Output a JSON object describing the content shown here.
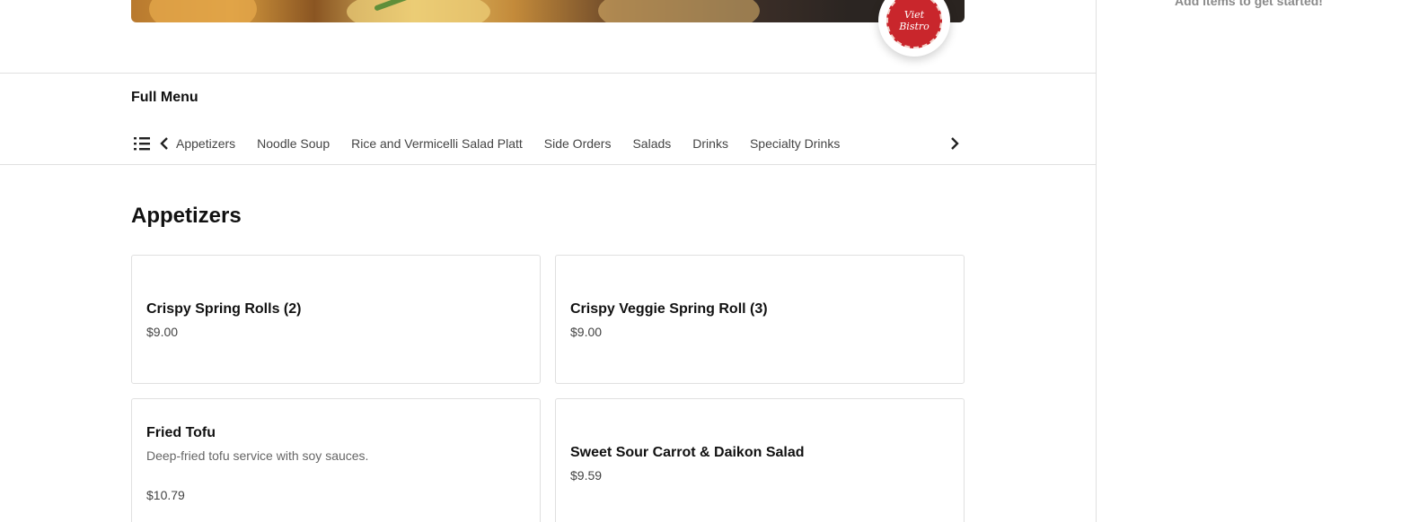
{
  "cart": {
    "empty_message": "Add items to get started!"
  },
  "restaurant": {
    "logo_text_line1": "Viet",
    "logo_text_line2": "Bistro"
  },
  "menu": {
    "title": "Full Menu",
    "categories": [
      "Appetizers",
      "Noodle Soup",
      "Rice and Vermicelli Salad Platt",
      "Side Orders",
      "Salads",
      "Drinks",
      "Specialty Drinks"
    ]
  },
  "section": {
    "title": "Appetizers",
    "items": [
      {
        "name": "Crispy Spring Rolls (2)",
        "description": "",
        "price": "$9.00"
      },
      {
        "name": "Crispy Veggie Spring Roll (3)",
        "description": "",
        "price": "$9.00"
      },
      {
        "name": "Fried Tofu",
        "description": "Deep-fried tofu service with soy sauces.",
        "price": "$10.79"
      },
      {
        "name": "Sweet Sour Carrot & Daikon Salad",
        "description": "",
        "price": "$9.59"
      }
    ]
  },
  "icons": {
    "list": "list-icon",
    "prev": "chevron-left-icon",
    "next": "chevron-right-icon"
  }
}
